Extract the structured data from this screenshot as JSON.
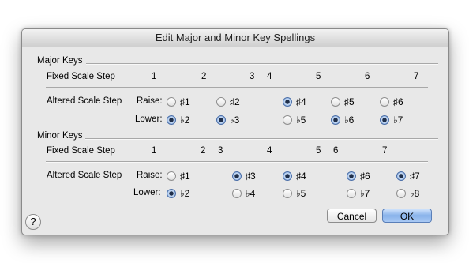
{
  "dialog": {
    "title": "Edit Major and Minor Key Spellings"
  },
  "major": {
    "section_label": "Major Keys",
    "fixed_label": "Fixed Scale Step",
    "fixed_steps": [
      "1",
      "2",
      "3",
      "4",
      "5",
      "6",
      "7"
    ],
    "altered_label": "Altered Scale Step",
    "raise_label": "Raise:",
    "lower_label": "Lower:",
    "raise_options": [
      {
        "label": "♯1",
        "selected": false
      },
      {
        "label": "♯2",
        "selected": false
      },
      {
        "label": "♯4",
        "selected": true
      },
      {
        "label": "♯5",
        "selected": false
      },
      {
        "label": "♯6",
        "selected": false
      }
    ],
    "lower_options": [
      {
        "label": "♭2",
        "selected": true
      },
      {
        "label": "♭3",
        "selected": true
      },
      {
        "label": "♭5",
        "selected": false
      },
      {
        "label": "♭6",
        "selected": true
      },
      {
        "label": "♭7",
        "selected": true
      }
    ]
  },
  "minor": {
    "section_label": "Minor Keys",
    "fixed_label": "Fixed Scale Step",
    "fixed_steps": [
      "1",
      "2",
      "3",
      "4",
      "5",
      "6",
      "7"
    ],
    "altered_label": "Altered Scale Step",
    "raise_label": "Raise:",
    "lower_label": "Lower:",
    "raise_options": [
      {
        "label": "♯1",
        "selected": false
      },
      {
        "label": "♯3",
        "selected": true
      },
      {
        "label": "♯4",
        "selected": true
      },
      {
        "label": "♯6",
        "selected": true
      },
      {
        "label": "♯7",
        "selected": true
      }
    ],
    "lower_options": [
      {
        "label": "♭2",
        "selected": true
      },
      {
        "label": "♭4",
        "selected": false
      },
      {
        "label": "♭5",
        "selected": false
      },
      {
        "label": "♭7",
        "selected": false
      },
      {
        "label": "♭8",
        "selected": false
      }
    ]
  },
  "buttons": {
    "cancel": "Cancel",
    "ok": "OK",
    "help": "?"
  }
}
